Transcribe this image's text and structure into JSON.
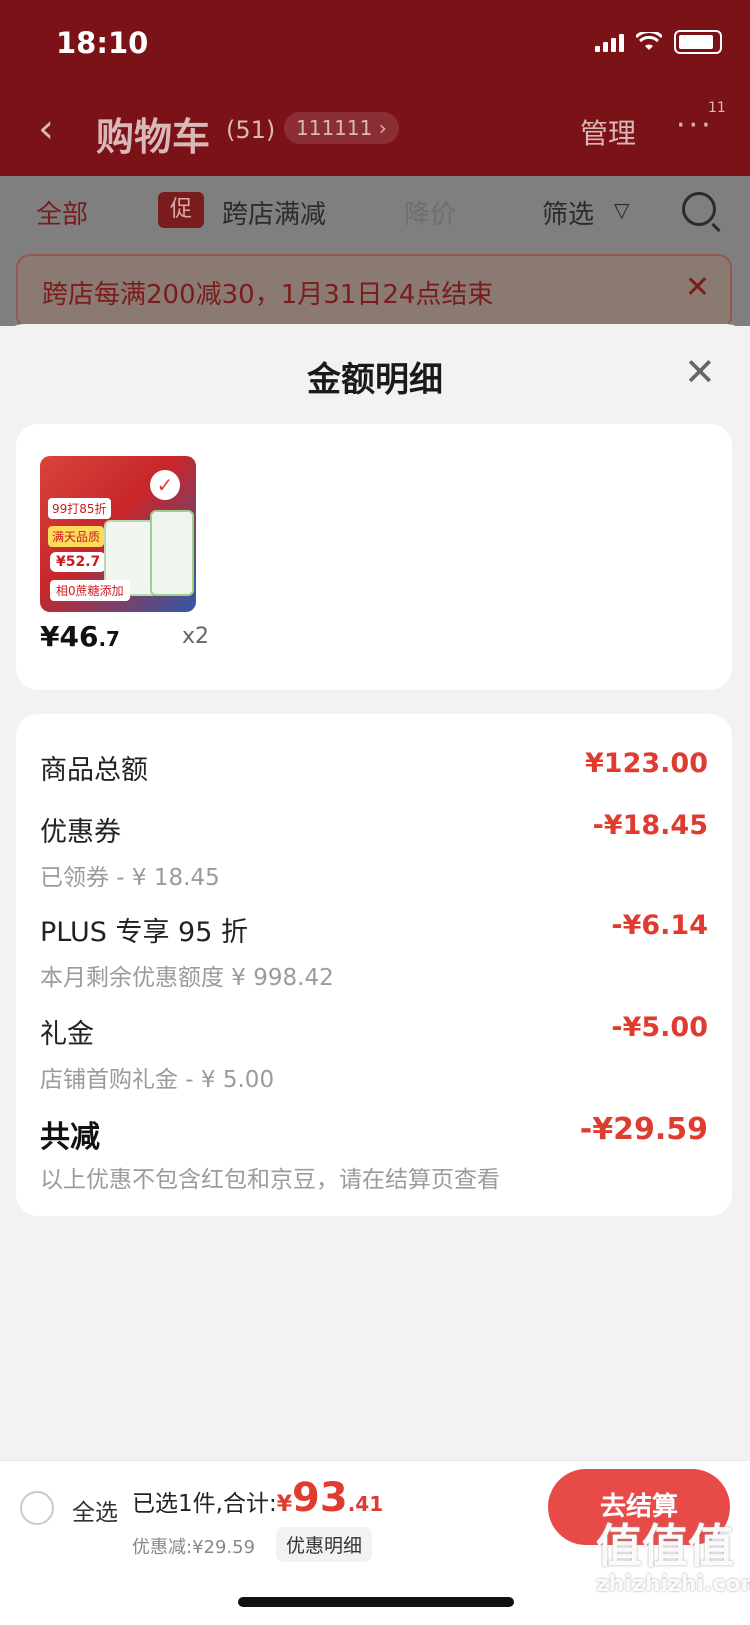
{
  "status": {
    "time": "18:10"
  },
  "nav": {
    "back": "‹",
    "title": "购物车",
    "count": "(51)",
    "pill": "111111 ›",
    "manage": "管理",
    "more": "···",
    "badge": "11"
  },
  "tabs": {
    "all": "全部",
    "promo_badge": "促",
    "cross": "跨店满减",
    "drop": "降价",
    "filter": "筛选",
    "filter_icon": "funnel-icon"
  },
  "banner": {
    "text": "跨店每满200减30，1月31日24点结束",
    "close": "✕"
  },
  "sheet": {
    "title": "金额明细",
    "close": "✕"
  },
  "product": {
    "image_badge": "✓",
    "tag1": "99打85折",
    "tag2": "满天品质",
    "image_price": "¥52.7",
    "bottom_tag": "相0蔗糖添加",
    "price_int": "¥46",
    "price_dec": ".7",
    "qty": "x2"
  },
  "details": {
    "total_label": "商品总额",
    "total_value": "¥123.00",
    "coupon_label": "优惠券",
    "coupon_value": "-¥18.45",
    "coupon_sub": "已领券 - ¥ 18.45",
    "plus_label": "PLUS 专享 95 折",
    "plus_value": "-¥6.14",
    "plus_sub": "本月剩余优惠额度 ¥ 998.42",
    "gift_label": "礼金",
    "gift_value": "-¥5.00",
    "gift_sub": "店铺首购礼金 - ¥ 5.00",
    "reduce_label": "共减",
    "reduce_value": "-¥29.59",
    "reduce_sub": "以上优惠不包含红包和京豆，请在结算页查看"
  },
  "bottom": {
    "select_all": "全选",
    "selected": "已选1件,合计:",
    "yen": "¥",
    "amount_int": "93",
    "amount_dec": ".41",
    "discount": "优惠减:¥29.59",
    "detail_chip": "优惠明细",
    "checkout": "去结算"
  },
  "watermark": {
    "big": "值值值",
    "small": "zhizhizhi.com"
  },
  "colors": {
    "accent": "#e03b2f",
    "checkout": "#e84a48",
    "dim_red": "#7a1218"
  }
}
